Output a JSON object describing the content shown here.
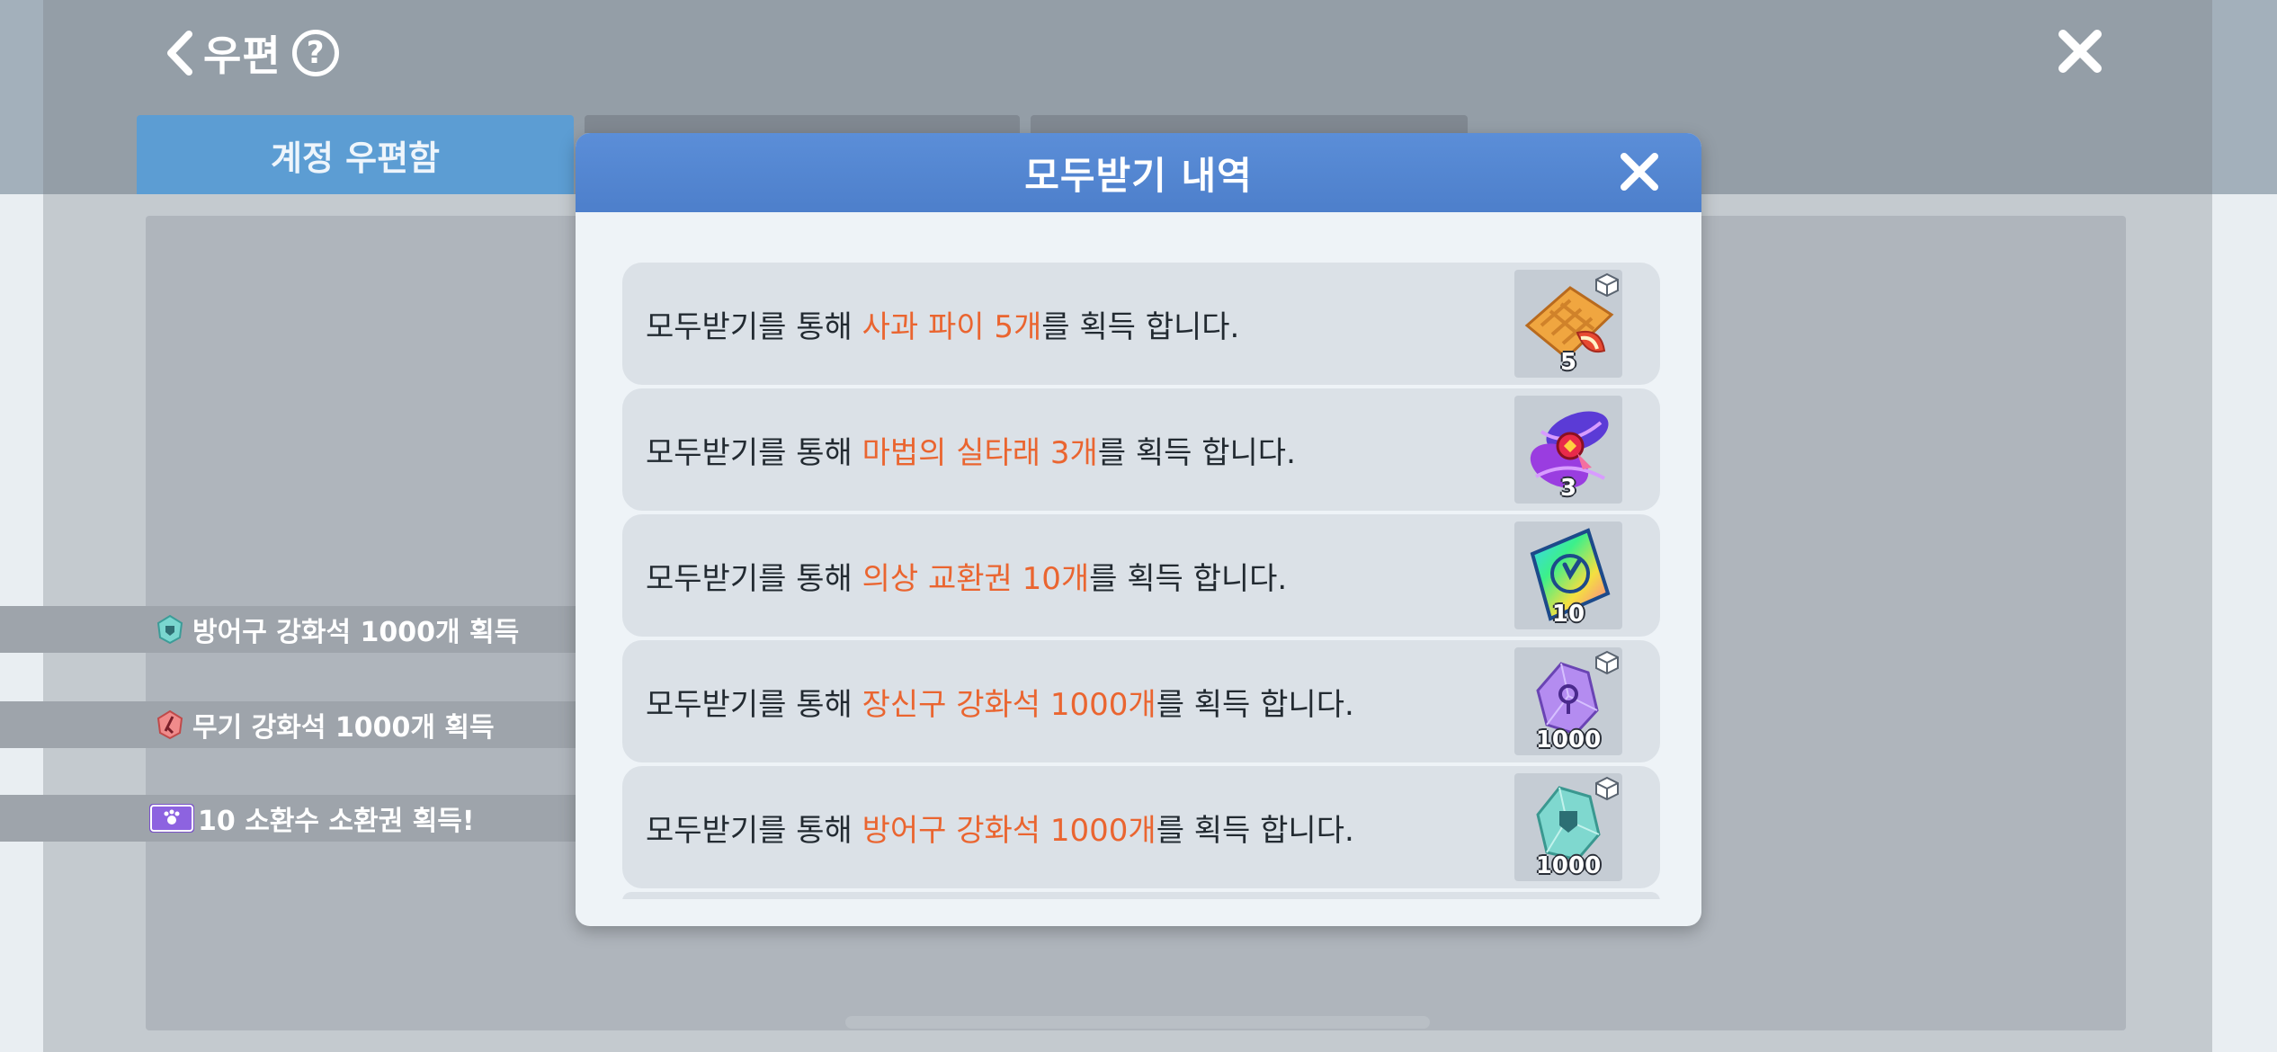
{
  "header": {
    "title": "우편",
    "help_glyph": "?"
  },
  "tabs": [
    {
      "label": "계정 우편함"
    },
    {
      "label": ""
    },
    {
      "label": ""
    }
  ],
  "toasts": [
    {
      "text": "방어구 강화석 1000개 획득",
      "icon": "armor-stone-icon"
    },
    {
      "text": "무기 강화석 1000개 획득",
      "icon": "weapon-stone-icon"
    },
    {
      "text": "10 소환수 소환권 획득!",
      "icon": "summon-ticket-icon"
    }
  ],
  "modal": {
    "title": "모두받기 내역",
    "rows": [
      {
        "prefix": "모두받기를 통해 ",
        "item": "사과 파이 5개",
        "suffix": "를 획득 합니다.",
        "count": "5",
        "icon": "apple-pie-icon"
      },
      {
        "prefix": "모두받기를 통해 ",
        "item": "마법의 실타래 3개",
        "suffix": "를 획득 합니다.",
        "count": "3",
        "icon": "magic-thread-icon"
      },
      {
        "prefix": "모두받기를 통해 ",
        "item": "의상 교환권 10개",
        "suffix": "를 획득 합니다.",
        "count": "10",
        "icon": "costume-ticket-icon"
      },
      {
        "prefix": "모두받기를 통해 ",
        "item": "장신구 강화석 1000개",
        "suffix": "를 획득 합니다.",
        "count": "1000",
        "icon": "accessory-stone-icon"
      },
      {
        "prefix": "모두받기를 통해 ",
        "item": "방어구 강화석 1000개",
        "suffix": "를 획득 합니다.",
        "count": "1000",
        "icon": "armor-stone-icon"
      }
    ]
  },
  "colors": {
    "highlight": "#ea6530",
    "modal_header": "#5b8ed8",
    "tab_active": "#5c9dd3"
  }
}
